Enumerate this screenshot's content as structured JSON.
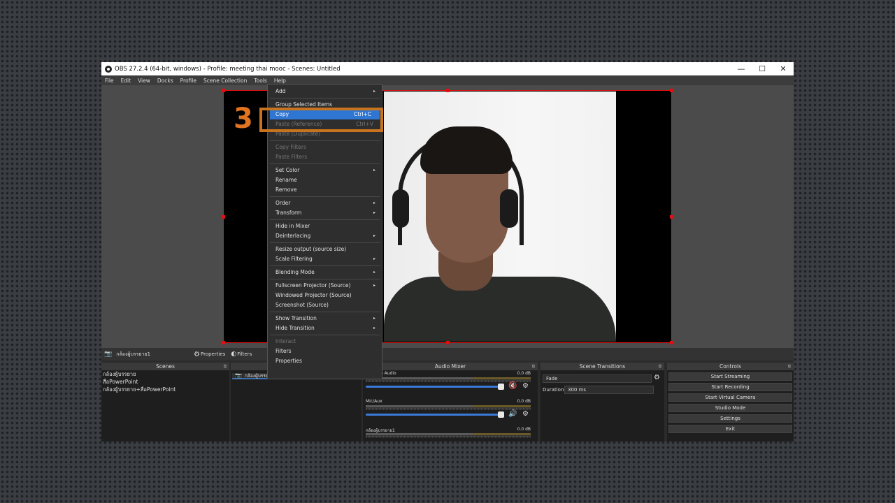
{
  "window": {
    "title": "OBS 27.2.4 (64-bit, windows) - Profile: meeting thai mooc - Scenes: Untitled",
    "minimize": "—",
    "maximize": "☐",
    "close": "✕"
  },
  "menubar": [
    "File",
    "Edit",
    "View",
    "Docks",
    "Profile",
    "Scene Collection",
    "Tools",
    "Help"
  ],
  "annotation": {
    "step": "3"
  },
  "context_menu": {
    "items": [
      {
        "label": "Add",
        "arrow": "▸"
      },
      {
        "sep": true
      },
      {
        "label": "Group Selected Items"
      },
      {
        "label": "Copy",
        "shortcut": "Ctrl+C",
        "selected": true
      },
      {
        "label": "Paste (Reference)",
        "shortcut": "Ctrl+V",
        "disabled": true
      },
      {
        "label": "Paste (Duplicate)",
        "disabled": true
      },
      {
        "sep": true
      },
      {
        "label": "Copy Filters",
        "disabled": true
      },
      {
        "label": "Paste Filters",
        "disabled": true
      },
      {
        "sep": true
      },
      {
        "label": "Set Color",
        "arrow": "▸"
      },
      {
        "label": "Rename"
      },
      {
        "label": "Remove"
      },
      {
        "sep": true
      },
      {
        "label": "Order",
        "arrow": "▸"
      },
      {
        "label": "Transform",
        "arrow": "▸"
      },
      {
        "sep": true
      },
      {
        "label": "Hide in Mixer"
      },
      {
        "label": "Deinterlacing",
        "arrow": "▸"
      },
      {
        "sep": true
      },
      {
        "label": "Resize output (source size)"
      },
      {
        "label": "Scale Filtering",
        "arrow": "▸"
      },
      {
        "sep": true
      },
      {
        "label": "Blending Mode",
        "arrow": "▸"
      },
      {
        "sep": true
      },
      {
        "label": "Fullscreen Projector (Source)",
        "arrow": "▸"
      },
      {
        "label": "Windowed Projector (Source)"
      },
      {
        "label": "Screenshot (Source)"
      },
      {
        "sep": true
      },
      {
        "label": "Show Transition",
        "arrow": "▸"
      },
      {
        "label": "Hide Transition",
        "arrow": "▸"
      },
      {
        "sep": true
      },
      {
        "label": "Interact",
        "disabled": true
      },
      {
        "label": "Filters"
      },
      {
        "label": "Properties"
      }
    ]
  },
  "source_toolbar": {
    "source_name": "กล้องผู้บรรยาย1",
    "properties": "Properties",
    "filters": "Filters"
  },
  "scenes": {
    "title": "Scenes",
    "items": [
      "กล้องผู้บรรยาย",
      "สื่อPowerPoint",
      "กล้องผู้บรรยาย+สื่อPowerPoint"
    ]
  },
  "sources": {
    "row": "กล้องผู้บรรยา"
  },
  "audio_mixer": {
    "title": "Audio Mixer",
    "channels": [
      {
        "name": "Desktop Audio",
        "db": "0.0 dB",
        "muted": true
      },
      {
        "name": "Mic/Aux",
        "db": "0.0 dB",
        "muted": false
      },
      {
        "name": "กล้องผู้บรรยาย1",
        "db": "0.0 dB",
        "muted": false
      }
    ]
  },
  "scene_transitions": {
    "title": "Scene Transitions",
    "transition": "Fade",
    "duration_label": "Duration",
    "duration_value": "300 ms"
  },
  "controls": {
    "title": "Controls",
    "buttons": [
      "Start Streaming",
      "Start Recording",
      "Start Virtual Camera",
      "Studio Mode",
      "Settings",
      "Exit"
    ]
  },
  "colors": {
    "selection_red": "#e01010",
    "annotation_orange": "#c8741f",
    "menu_highlight": "#2f76d2"
  }
}
